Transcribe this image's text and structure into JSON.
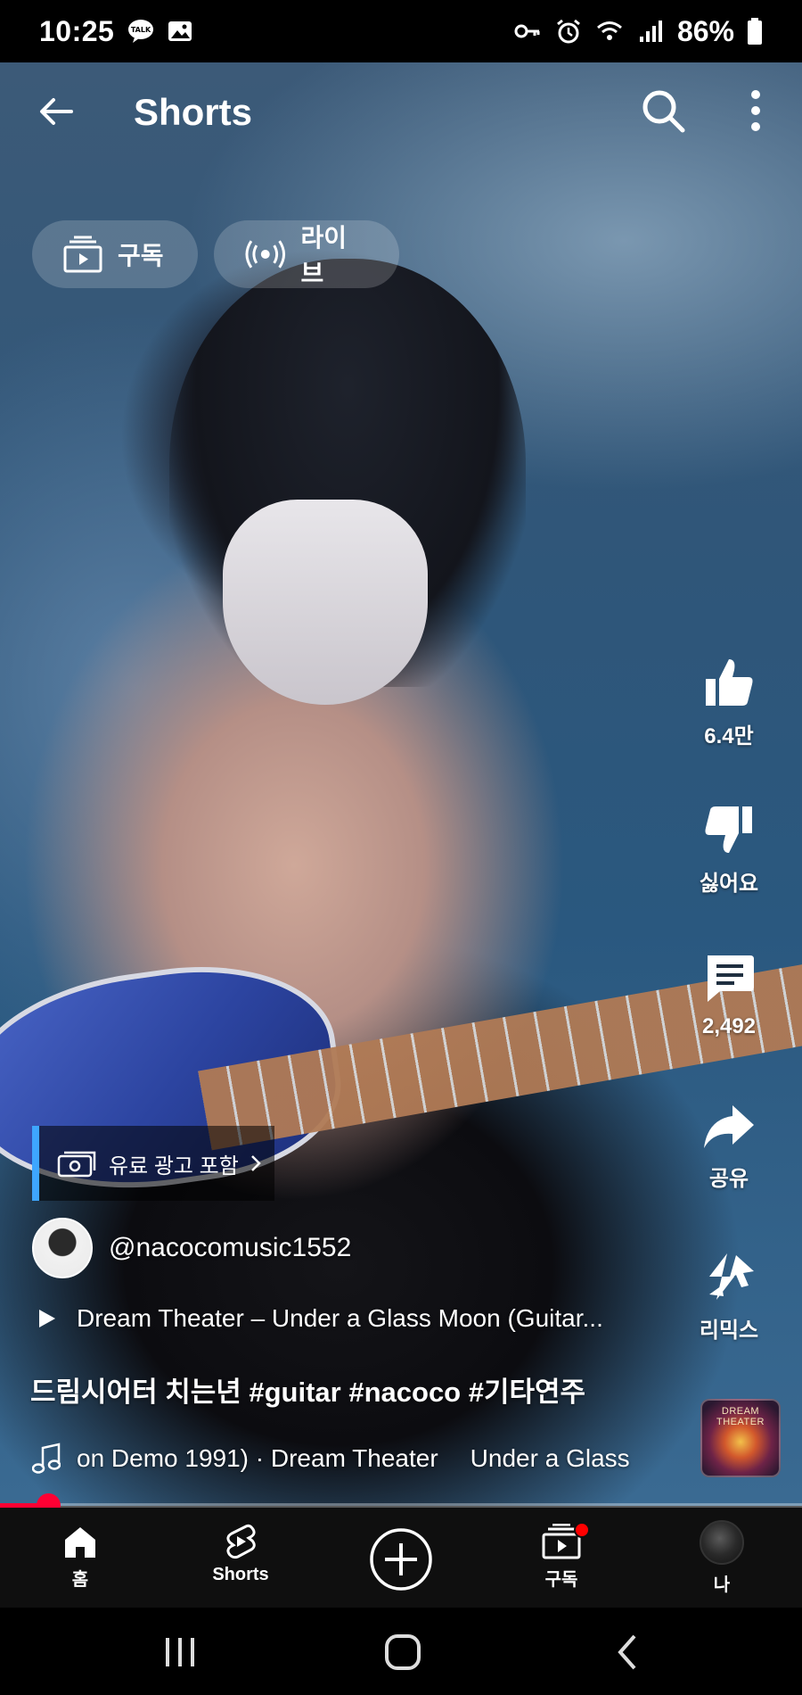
{
  "status_bar": {
    "time": "10:25",
    "battery": "86%",
    "left_icons": [
      "talk-icon",
      "gallery-icon"
    ],
    "right_icons": [
      "vpn-key-icon",
      "alarm-icon",
      "wifi-icon",
      "signal-icon",
      "battery-icon"
    ]
  },
  "header": {
    "title": "Shorts"
  },
  "chips": [
    {
      "label": "구독",
      "icon": "subscriptions-icon"
    },
    {
      "label": "라이브",
      "icon": "live-icon"
    }
  ],
  "actions": {
    "like": {
      "label": "6.4만",
      "icon": "thumb-up-icon"
    },
    "dislike": {
      "label": "싫어요",
      "icon": "thumb-down-icon"
    },
    "comments": {
      "label": "2,492",
      "icon": "comment-icon"
    },
    "share": {
      "label": "공유",
      "icon": "share-icon"
    },
    "remix": {
      "label": "리믹스",
      "icon": "remix-icon"
    }
  },
  "video": {
    "ad_label": "유료 광고 포함",
    "channel": "@nacocomusic1552",
    "related_video": "Dream Theater – Under a Glass Moon (Guitar...",
    "caption": "드림시어터 치는년 #guitar #nacoco #기타연주",
    "sound_a": "on Demo 1991) · Dream Theater",
    "sound_b": "Under a Glass",
    "album_text": "DREAM THEATER",
    "progress_fraction": 0.06
  },
  "bottom_nav": {
    "items": [
      {
        "label": "홈",
        "icon": "home-icon"
      },
      {
        "label": "Shorts",
        "icon": "shorts-icon"
      },
      {
        "label": "",
        "icon": "create-icon"
      },
      {
        "label": "구독",
        "icon": "subscriptions-icon"
      },
      {
        "label": "나",
        "icon": "profile-avatar"
      }
    ]
  },
  "colors": {
    "accent_red": "#ff0033",
    "ad_bar": "#3ea6ff",
    "nav_bg": "#0f0f0f"
  }
}
